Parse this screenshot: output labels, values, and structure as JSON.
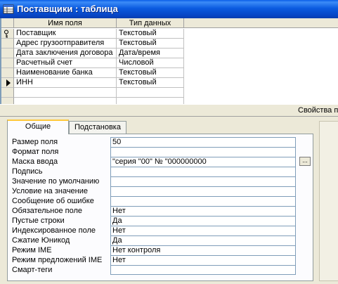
{
  "window": {
    "title": "Поставщики : таблица",
    "app_icon": "table-icon"
  },
  "design_grid": {
    "headers": {
      "field_name": "Имя поля",
      "data_type": "Тип данных"
    },
    "rows": [
      {
        "name": "Поставщик",
        "type": "Текстовый",
        "marker": "key-icon"
      },
      {
        "name": "Адрес грузоотправителя",
        "type": "Текстовый",
        "marker": ""
      },
      {
        "name": "Дата заключения договора",
        "type": "Дата/время",
        "marker": ""
      },
      {
        "name": "Расчетный счет",
        "type": "Числовой",
        "marker": ""
      },
      {
        "name": "Наименование банка",
        "type": "Текстовый",
        "marker": ""
      },
      {
        "name": "ИНН",
        "type": "Текстовый",
        "marker": "current-row-arrow-icon"
      },
      {
        "name": "",
        "type": "",
        "marker": ""
      },
      {
        "name": "",
        "type": "",
        "marker": ""
      }
    ]
  },
  "properties": {
    "section_title": "Свойства п",
    "tabs": [
      {
        "label": "Общие",
        "active": true
      },
      {
        "label": "Подстановка",
        "active": false
      }
    ],
    "rows": [
      {
        "label": "Размер поля",
        "value": "50"
      },
      {
        "label": "Формат поля",
        "value": ""
      },
      {
        "label": "Маска ввода",
        "value": "\"серия \"00\" № \"000000000"
      },
      {
        "label": "Подпись",
        "value": ""
      },
      {
        "label": "Значение по умолчанию",
        "value": ""
      },
      {
        "label": "Условие на значение",
        "value": ""
      },
      {
        "label": "Сообщение об ошибке",
        "value": ""
      },
      {
        "label": "Обязательное поле",
        "value": "Нет"
      },
      {
        "label": "Пустые строки",
        "value": "Да"
      },
      {
        "label": "Индексированное поле",
        "value": "Нет"
      },
      {
        "label": "Сжатие Юникод",
        "value": "Да"
      },
      {
        "label": "Режим IME",
        "value": "Нет контроля"
      },
      {
        "label": "Режим предложений IME",
        "value": "Нет"
      },
      {
        "label": "Смарт-теги",
        "value": ""
      }
    ],
    "builder_button": "..."
  }
}
